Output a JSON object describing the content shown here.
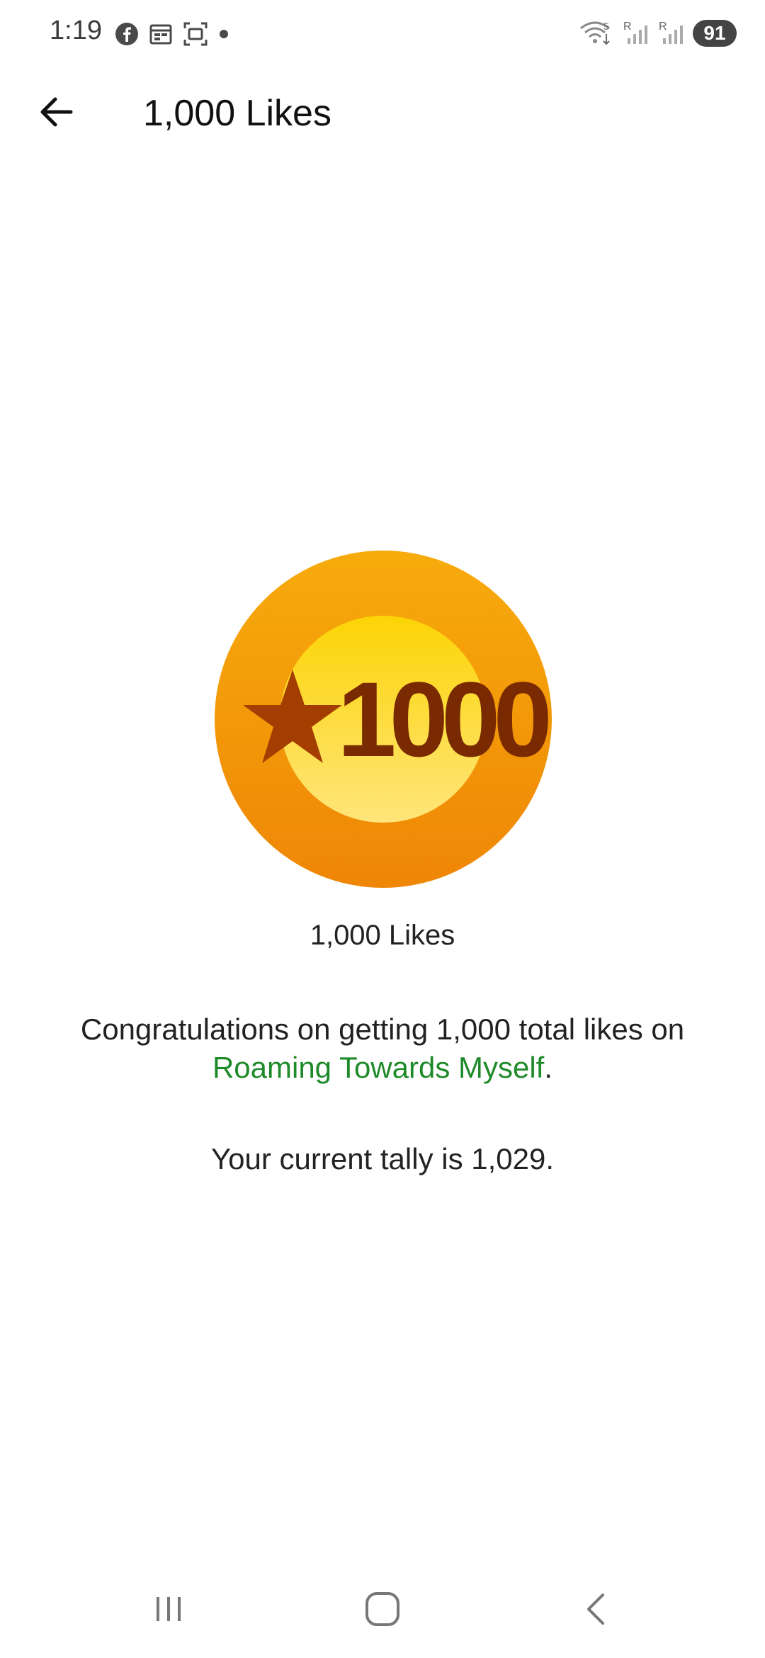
{
  "status_bar": {
    "time": "1:19",
    "battery": "91",
    "left_icons": [
      "facebook-icon",
      "calendar-icon",
      "screenshot-icon",
      "dot-icon"
    ],
    "right_icons": [
      "wifi-icon",
      "signal-r-icon",
      "signal-r-icon"
    ]
  },
  "app_bar": {
    "title": "1,000 Likes",
    "back_icon": "back-arrow-icon"
  },
  "badge": {
    "number": "1000",
    "outer_color": "#f5a10a",
    "inner_color": "#ffe066",
    "text_color": "#7a2a00"
  },
  "content": {
    "badge_label": "1,000 Likes",
    "message_prefix": "Congratulations on getting 1,000 total likes on",
    "blog_link": "Roaming Towards Myself",
    "message_suffix": ".",
    "tally": "Your current tally is 1,029."
  },
  "colors": {
    "link": "#1f8a2a"
  },
  "nav_bar": {
    "items": [
      "recent-apps-icon",
      "home-icon",
      "back-icon"
    ]
  }
}
